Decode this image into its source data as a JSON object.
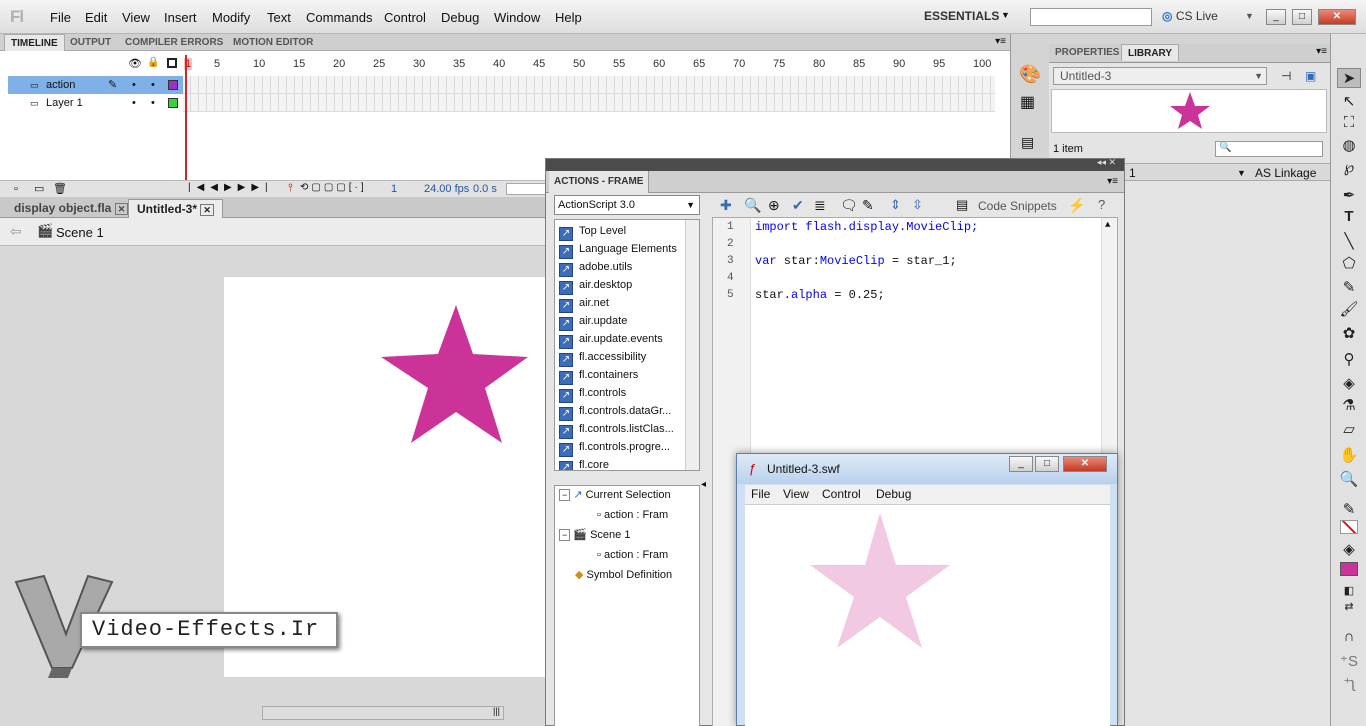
{
  "menubar": {
    "logo": "Fl",
    "items": [
      "File",
      "Edit",
      "View",
      "Insert",
      "Modify",
      "Text",
      "Commands",
      "Control",
      "Debug",
      "Window",
      "Help"
    ],
    "workspace": "ESSENTIALS",
    "search_placeholder": "",
    "cs_live": "CS Live"
  },
  "timeline": {
    "tabs": [
      "TIMELINE",
      "OUTPUT",
      "COMPILER ERRORS",
      "MOTION EDITOR"
    ],
    "ruler": [
      "1",
      "5",
      "10",
      "15",
      "20",
      "25",
      "30",
      "35",
      "40",
      "45",
      "50",
      "55",
      "60",
      "65",
      "70",
      "75",
      "80",
      "85",
      "90",
      "95",
      "100"
    ],
    "layers": [
      {
        "name": "action",
        "color": "#9b30c8",
        "selected": true
      },
      {
        "name": "Layer 1",
        "color": "#3bd13b",
        "selected": false
      }
    ],
    "footer": {
      "frame": "1",
      "fps": "24.00 fps",
      "time": "0.0 s"
    }
  },
  "documents": {
    "tabs": [
      "display object.fla",
      "Untitled-3*"
    ],
    "scene": "Scene 1"
  },
  "library": {
    "tabs": [
      "PROPERTIES",
      "LIBRARY"
    ],
    "document": "Untitled-3",
    "count": "1 item",
    "column_fragment": "1",
    "linkage_header": "AS Linkage"
  },
  "actions": {
    "title": "ACTIONS - FRAME",
    "version": "ActionScript 3.0",
    "tree": [
      "Top Level",
      "Language Elements",
      "adobe.utils",
      "air.desktop",
      "air.net",
      "air.update",
      "air.update.events",
      "fl.accessibility",
      "fl.containers",
      "fl.controls",
      "fl.controls.dataGr...",
      "fl.controls.listClas...",
      "fl.controls.progre...",
      "fl.core"
    ],
    "nav": {
      "current_selection": "Current Selection",
      "action_frame_1": "action : Fram",
      "scene": "Scene 1",
      "action_frame_2": "action : Fram",
      "symbol_defs": "Symbol Definition"
    },
    "code_snippets": "Code Snippets",
    "code": {
      "l1a": "import",
      "l1b": " flash.display.MovieClip;",
      "l3a": "var",
      "l3b": " star:",
      "l3c": "MovieClip",
      "l3d": " = star_1;",
      "l5a": "star.",
      "l5b": "alpha",
      "l5c": " = 0.25;",
      "lines": [
        "1",
        "2",
        "3",
        "4",
        "5"
      ]
    }
  },
  "swf": {
    "title": "Untitled-3.swf",
    "menu": [
      "File",
      "View",
      "Control",
      "Debug"
    ]
  },
  "watermark": "Video-Effects.Ir",
  "colors": {
    "star": "#cc3399",
    "star_faded": "#f2c9e2",
    "accent_tab": "#7fb1e8"
  }
}
